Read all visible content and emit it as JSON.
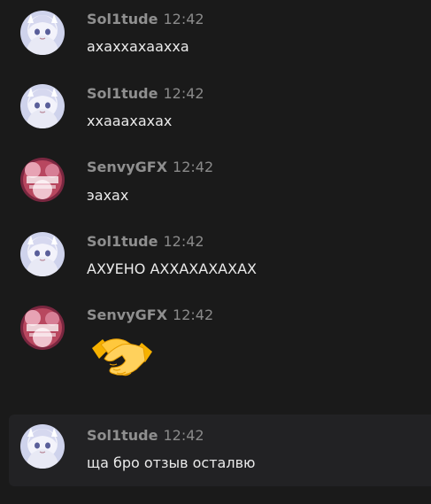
{
  "colors": {
    "background": "#1a1a1a",
    "highlight": "#222224",
    "author": "#8f8f8f",
    "text": "#eaeaea"
  },
  "messages": [
    {
      "author": "Sol1tude",
      "time": "12:42",
      "text": "ахаххахааххa",
      "avatar": "sol1tude-avatar-icon"
    },
    {
      "author": "Sol1tude",
      "time": "12:42",
      "text": "ххааахахах",
      "avatar": "sol1tude-avatar-icon"
    },
    {
      "author": "SenvyGFX",
      "time": "12:42",
      "text": "эахах",
      "avatar": "senvygfx-avatar-icon"
    },
    {
      "author": "Sol1tude",
      "time": "12:42",
      "text": "АХУЕНО АХХАХАХАХАХ",
      "avatar": "sol1tude-avatar-icon"
    },
    {
      "author": "SenvyGFX",
      "time": "12:42",
      "text": "",
      "emoji": "handshake-emoji-icon",
      "avatar": "senvygfx-avatar-icon"
    },
    {
      "author": "Sol1tude",
      "time": "12:42",
      "text": "ща бро отзыв осталвю",
      "avatar": "sol1tude-avatar-icon"
    }
  ]
}
